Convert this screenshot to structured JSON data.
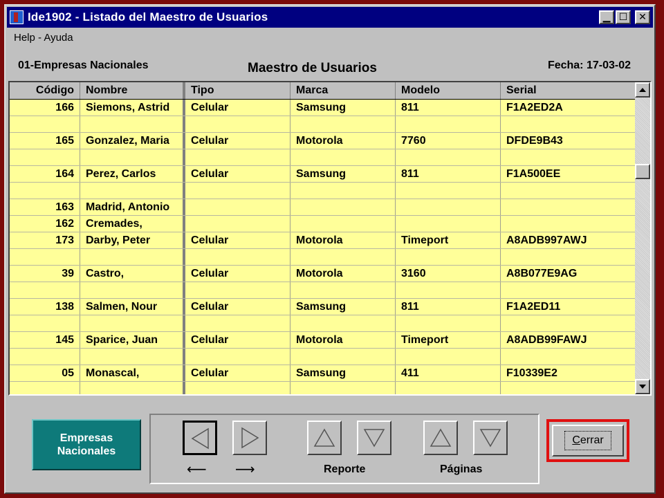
{
  "window": {
    "title": "Ide1902 - Listado del Maestro de Usuarios"
  },
  "menu": {
    "help": "Help - Ayuda"
  },
  "header": {
    "company": "01-Empresas Nacionales",
    "title": "Maestro de Usuarios",
    "date": "Fecha: 17-03-02"
  },
  "table": {
    "columns": [
      "Código",
      "Nombre",
      "Tipo",
      "Marca",
      "Modelo",
      "Serial"
    ],
    "rows": [
      [
        "166",
        "Siemons, Astrid",
        "Celular",
        "Samsung",
        "811",
        "F1A2ED2A"
      ],
      [
        "",
        "",
        "",
        "",
        "",
        ""
      ],
      [
        "165",
        "Gonzalez, Maria",
        "Celular",
        "Motorola",
        "7760",
        "DFDE9B43"
      ],
      [
        "",
        "",
        "",
        "",
        "",
        ""
      ],
      [
        "164",
        "Perez, Carlos",
        "Celular",
        "Samsung",
        "811",
        "F1A500EE"
      ],
      [
        "",
        "",
        "",
        "",
        "",
        ""
      ],
      [
        "163",
        "Madrid, Antonio",
        "",
        "",
        "",
        ""
      ],
      [
        "162",
        "Cremades,",
        "",
        "",
        "",
        ""
      ],
      [
        "173",
        "Darby, Peter",
        "Celular",
        "Motorola",
        "Timeport",
        "A8ADB997AWJ"
      ],
      [
        "",
        "",
        "",
        "",
        "",
        ""
      ],
      [
        "39",
        "Castro,",
        "Celular",
        "Motorola",
        "3160",
        "A8B077E9AG"
      ],
      [
        "",
        "",
        "",
        "",
        "",
        ""
      ],
      [
        "138",
        "Salmen, Nour",
        "Celular",
        "Samsung",
        "811",
        "F1A2ED11"
      ],
      [
        "",
        "",
        "",
        "",
        "",
        ""
      ],
      [
        "145",
        "Sparice, Juan",
        "Celular",
        "Motorola",
        "Timeport",
        "A8ADB99FAWJ"
      ],
      [
        "",
        "",
        "",
        "",
        "",
        ""
      ],
      [
        "05",
        "Monascal,",
        "Celular",
        "Samsung",
        "411",
        "F10339E2"
      ],
      [
        "",
        "",
        "",
        "",
        "",
        ""
      ]
    ]
  },
  "buttons": {
    "empresas_line1": "Empresas",
    "empresas_line2": "Nacionales",
    "prev_arrow": "⟵",
    "next_arrow": "⟶",
    "reporte": "Reporte",
    "paginas": "Páginas",
    "cerrar_first": "C",
    "cerrar_rest": "errar"
  },
  "icons": {
    "app": "app-icon",
    "minimize": "minimize-icon",
    "maximize": "maximize-icon",
    "close": "close-icon"
  },
  "colors": {
    "grid_bg": "#ffff99",
    "title_bar": "#000080",
    "empresas_btn": "#0e7a7a",
    "cerrar_border": "#e01010",
    "desktop": "#7a0a0a"
  }
}
